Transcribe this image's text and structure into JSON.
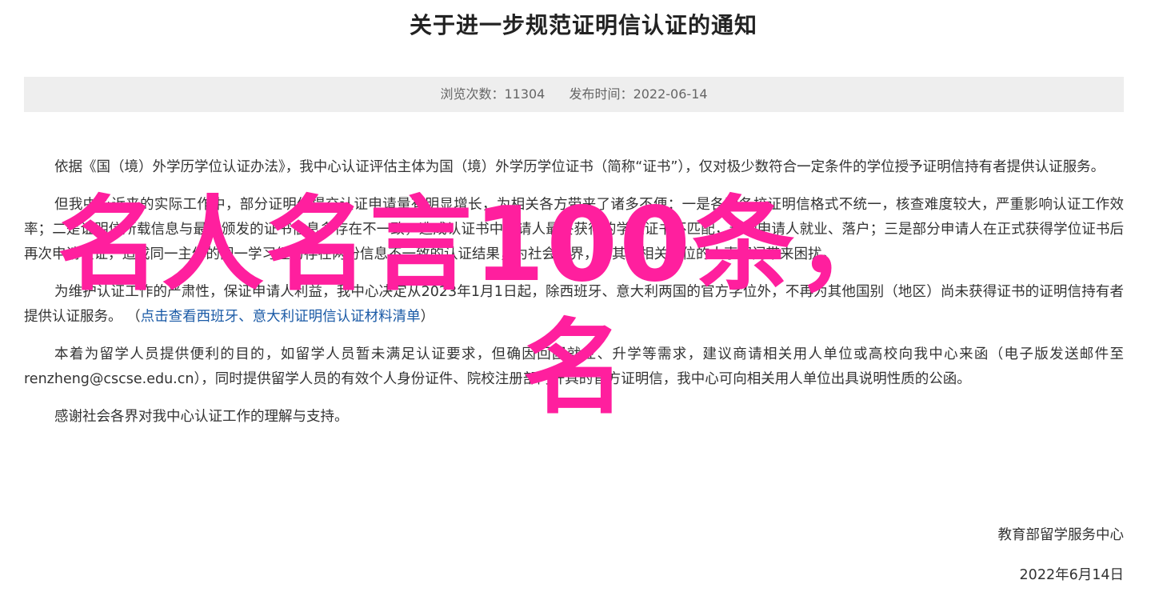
{
  "article": {
    "title": "关于进一步规范证明信认证的通知",
    "views_label": "浏览次数：",
    "views_value": "11304",
    "date_label": "发布时间：",
    "date_value": "2022-06-14",
    "paragraphs": [
      "依据《国（境）外学历学位认证办法》，我中心认证评估主体为国（境）外学历学位证书（简称“证书”），仅对极少数符合一定条件的学位授予证明信持有者提供认证服务。",
      "但我中心近来的实际工作中，部分证明信提交认证申请量有明显增长，为相关各方带来了诸多不便：一是各国各校证明信格式不统一，核查难度较大，严重影响认证工作效率；二是证明信所载信息与最终颁发的证书信息多存在不一致，造成认证书中申请人最终获得的学位证书不匹配，影响申请人就业、落户；三是部分申请人在正式获得学位证书后再次申请认证，造成同一主体的同一学习经历存在两份信息不一致的认证结果，为社会各界，尤其是相关单位的人事部门带来困扰。",
      "为维护认证工作的严肃性，保证申请人利益，我中心决定从2023年1月1日起，除西班牙、意大利两国的官方学位外，不再为其他国别（地区）尚未获得证书的证明信持有者提供认证服务。",
      "本着为留学人员提供便利的目的，如留学人员暂未满足认证要求，但确因回国就业、升学等需求，建议商请相关用人单位或高校向我中心来函（电子版发送邮件至renzheng@cscse.edu.cn），同时提供留学人员的有效个人身份证件、院校注册部门开具的官方证明信，我中心可向相关用人单位出具说明性质的公函。",
      "感谢社会各界对我中心认证工作的理解与支持。"
    ],
    "link_prefix": "（",
    "link_text": "点击查看西班牙、意大利证明信认证材料清单",
    "link_suffix": "）",
    "signature_org": "教育部留学服务中心",
    "signature_date": "2022年6月14日"
  },
  "overlay": {
    "line1": "名人名言100条，",
    "line2": "名",
    "color": "#ff1f9e"
  }
}
